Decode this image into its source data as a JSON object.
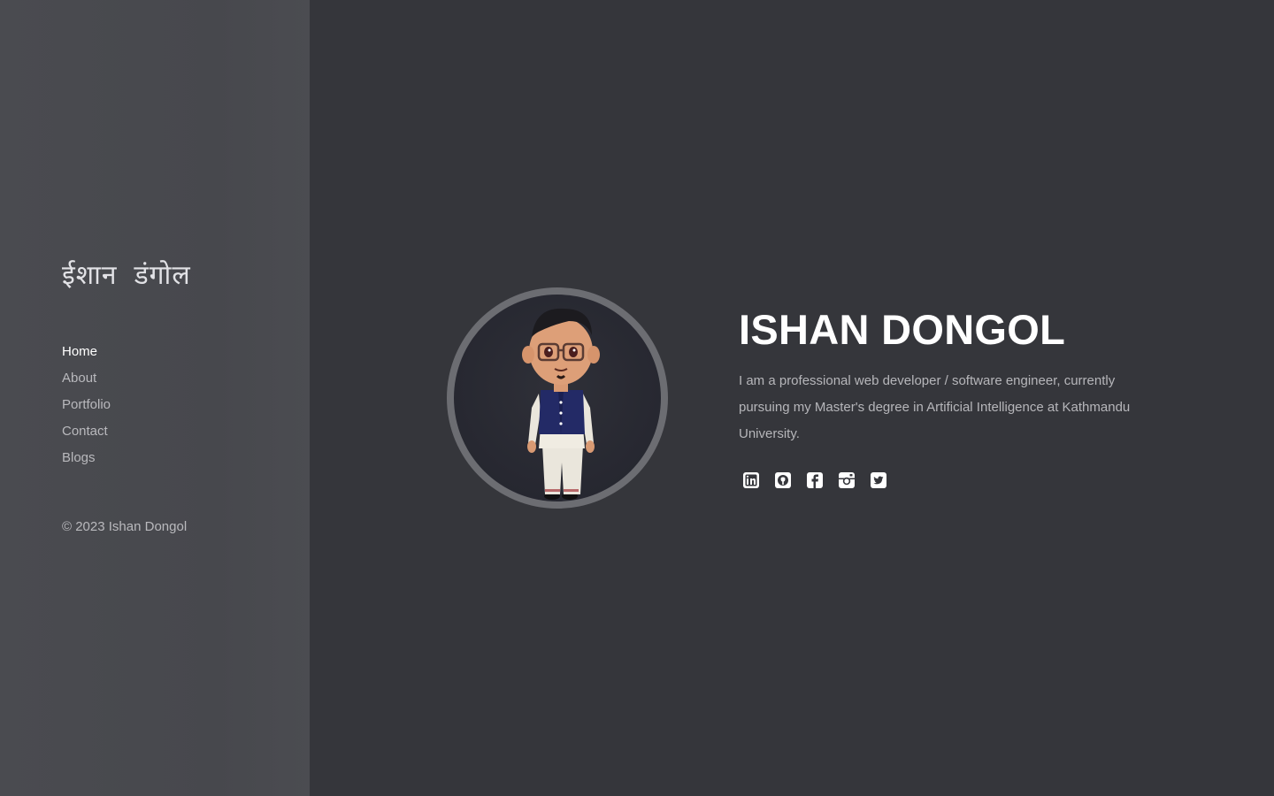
{
  "sidebar": {
    "logo_text": "ईशान डंगोल",
    "nav": [
      {
        "label": "Home",
        "active": true
      },
      {
        "label": "About",
        "active": false
      },
      {
        "label": "Portfolio",
        "active": false
      },
      {
        "label": "Contact",
        "active": false
      },
      {
        "label": "Blogs",
        "active": false
      }
    ],
    "copyright": "© 2023 Ishan Dongol"
  },
  "hero": {
    "avatar_icon": "avatar-character",
    "name": "ISHAN DONGOL",
    "bio": "I am a professional web developer / software engineer, currently pursuing my Master's degree in Artificial Intelligence at Kathmandu University.",
    "socials": [
      {
        "icon": "linkedin-icon"
      },
      {
        "icon": "github-icon"
      },
      {
        "icon": "facebook-icon"
      },
      {
        "icon": "instagram-icon"
      },
      {
        "icon": "twitter-icon"
      }
    ]
  },
  "colors": {
    "sidebar_bg": "#48494e",
    "main_bg": "#35363b",
    "text_primary": "#ffffff",
    "text_muted": "#b9b9bd"
  }
}
